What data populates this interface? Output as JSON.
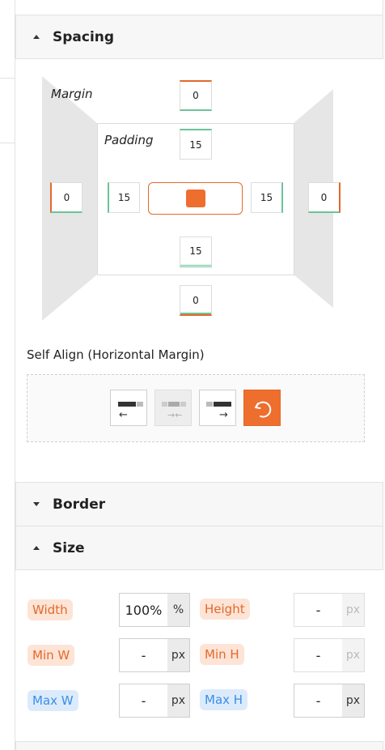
{
  "sections": {
    "spacing": {
      "title": "Spacing",
      "expanded": true
    },
    "border": {
      "title": "Border",
      "expanded": false
    },
    "size": {
      "title": "Size",
      "expanded": true
    }
  },
  "spacing": {
    "margin_label": "Margin",
    "padding_label": "Padding",
    "margin": {
      "top": "0",
      "right": "0",
      "bottom": "0",
      "left": "0"
    },
    "padding": {
      "top": "15",
      "right": "15",
      "bottom": "15",
      "left": "15"
    }
  },
  "self_align": {
    "label": "Self Align (Horizontal Margin)",
    "options": [
      "align-left",
      "align-center",
      "align-right",
      "reset"
    ]
  },
  "size": {
    "width": {
      "label": "Width",
      "value": "100%",
      "unit": "%"
    },
    "height": {
      "label": "Height",
      "value": "-",
      "unit": "px"
    },
    "min_w": {
      "label": "Min W",
      "value": "-",
      "unit": "px"
    },
    "min_h": {
      "label": "Min H",
      "value": "-",
      "unit": "px"
    },
    "max_w": {
      "label": "Max W",
      "value": "-",
      "unit": "px"
    },
    "max_h": {
      "label": "Max H",
      "value": "-",
      "unit": "px"
    }
  },
  "colors": {
    "accent": "#ee6e2e",
    "green": "#6cc39a",
    "blue": "#3a8ee6"
  }
}
